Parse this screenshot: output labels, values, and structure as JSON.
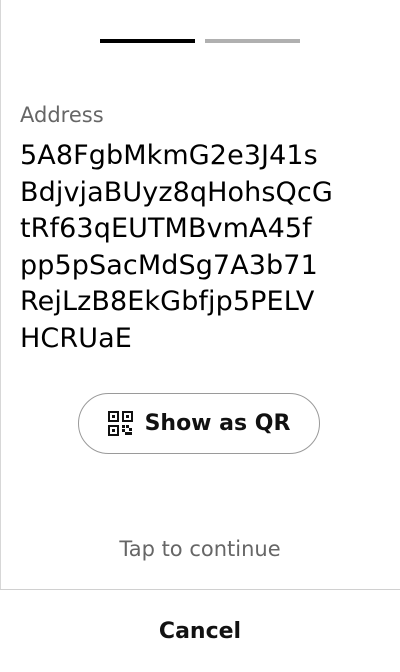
{
  "progress": {
    "current_step": 1,
    "total_steps": 2
  },
  "address": {
    "label": "Address",
    "lines": [
      "5A8FgbMkmG2e3J41s",
      "BdjvjaBUyz8qHohsQcG",
      "tRf63qEUTMBvmA45f",
      "pp5pSacMdSg7A3b71",
      "RejLzB8EkGbfjp5PELV",
      "HCRUaE"
    ]
  },
  "qr_button": {
    "label": "Show as QR",
    "icon": "qr-code-icon"
  },
  "hint": "Tap to continue",
  "cancel_label": "Cancel",
  "colors": {
    "step_active": "#000000",
    "step_inactive": "#b0b0b0",
    "muted_text": "#666666",
    "border": "#9a9a9a"
  }
}
